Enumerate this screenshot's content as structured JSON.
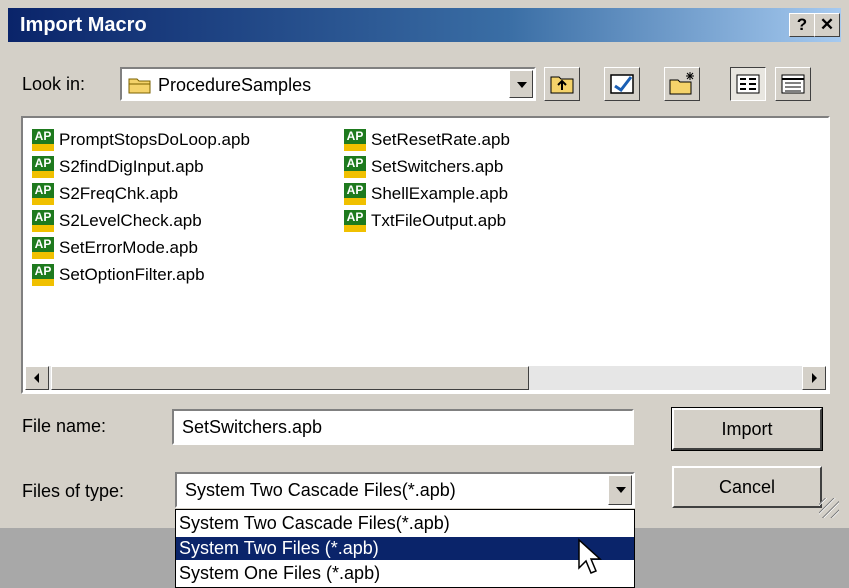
{
  "window": {
    "title": "Import Macro",
    "help_label": "?",
    "close_label": "✕"
  },
  "lookin": {
    "label": "Look in:",
    "value": "ProcedureSamples"
  },
  "files": [
    {
      "name": "PromptStopsDoLoop.apb"
    },
    {
      "name": "S2findDigInput.apb"
    },
    {
      "name": "S2FreqChk.apb"
    },
    {
      "name": "S2LevelCheck.apb"
    },
    {
      "name": "SetErrorMode.apb"
    },
    {
      "name": "SetOptionFilter.apb"
    },
    {
      "name": "SetResetRate.apb"
    },
    {
      "name": "SetSwitchers.apb"
    },
    {
      "name": "ShellExample.apb"
    },
    {
      "name": "TxtFileOutput.apb"
    }
  ],
  "icon_text": "AP",
  "filename": {
    "label": "File name:",
    "value": "SetSwitchers.apb"
  },
  "filetype": {
    "label": "Files of type:",
    "value": "System Two Cascade Files(*.apb)",
    "options": [
      "System Two Cascade Files(*.apb)",
      "System Two Files (*.apb)",
      "System One Files (*.apb)"
    ]
  },
  "buttons": {
    "import": "Import",
    "cancel": "Cancel"
  },
  "colors": {
    "titlebar": "#0a246a",
    "face": "#d4d0c8",
    "selection": "#0a246a"
  }
}
